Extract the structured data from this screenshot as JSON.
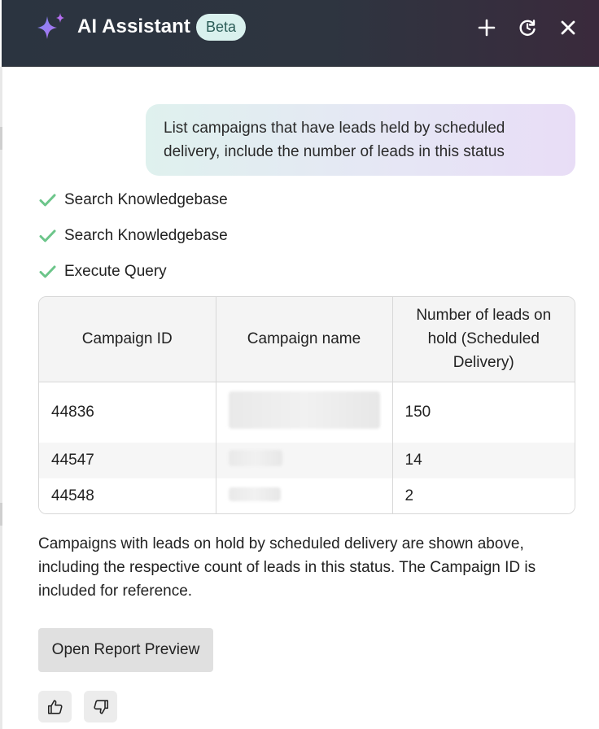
{
  "header": {
    "title": "AI Assistant",
    "badge": "Beta",
    "icons": [
      "sparkle-icon",
      "plus-icon",
      "history-icon",
      "close-icon"
    ]
  },
  "conversation": {
    "user_message": "List campaigns that have leads held by scheduled delivery, include the number of leads in this status",
    "steps": [
      {
        "label": "Search Knowledgebase",
        "status": "done"
      },
      {
        "label": "Search Knowledgebase",
        "status": "done"
      },
      {
        "label": "Execute Query",
        "status": "done"
      }
    ],
    "table": {
      "columns": [
        "Campaign ID",
        "Campaign name",
        "Number of leads on hold (Scheduled Delivery)"
      ],
      "rows": [
        {
          "campaign_id": "44836",
          "campaign_name": "",
          "leads": "150"
        },
        {
          "campaign_id": "44547",
          "campaign_name": "",
          "leads": "14"
        },
        {
          "campaign_id": "44548",
          "campaign_name": "",
          "leads": "2"
        }
      ]
    },
    "summary": "Campaigns with leads on hold by scheduled delivery are shown above, including the respective count of leads in this status. The Campaign ID is included for reference.",
    "report_button": "Open Report Preview"
  },
  "colors": {
    "header_bg": "#2b3440",
    "badge_bg": "#d9f1ee",
    "check": "#6cc58a",
    "button_bg": "#e0e0e0"
  }
}
